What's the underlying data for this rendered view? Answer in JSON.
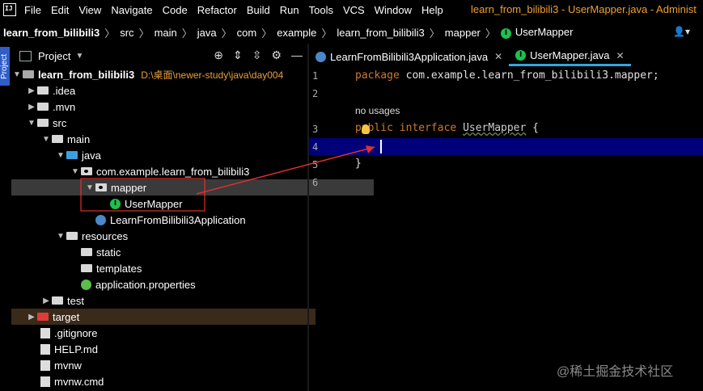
{
  "menu": {
    "logo": "IJ",
    "items": [
      "File",
      "Edit",
      "View",
      "Navigate",
      "Code",
      "Refactor",
      "Build",
      "Run",
      "Tools",
      "VCS",
      "Window",
      "Help"
    ],
    "window_title": "learn_from_bilibili3 - UserMapper.java - Administ"
  },
  "breadcrumb": [
    "learn_from_bilibili3",
    "src",
    "main",
    "java",
    "com",
    "example",
    "learn_from_bilibili3",
    "mapper",
    "UserMapper"
  ],
  "side_tab": "Project",
  "project": {
    "title": "Project",
    "root_name": "learn_from_bilibili3",
    "root_path": "D:\\桌面\\newer-study\\java\\day004",
    "nodes": [
      {
        "label": ".idea"
      },
      {
        "label": ".mvn"
      },
      {
        "label": "src"
      },
      {
        "label": "main"
      },
      {
        "label": "java"
      },
      {
        "label": "com.example.learn_from_bilibili3"
      },
      {
        "label": "mapper"
      },
      {
        "label": "UserMapper"
      },
      {
        "label": "LearnFromBilibili3Application"
      },
      {
        "label": "resources"
      },
      {
        "label": "static"
      },
      {
        "label": "templates"
      },
      {
        "label": "application.properties"
      },
      {
        "label": "test"
      },
      {
        "label": "target"
      },
      {
        "label": ".gitignore"
      },
      {
        "label": "HELP.md"
      },
      {
        "label": "mvnw"
      },
      {
        "label": "mvnw.cmd"
      }
    ]
  },
  "tabs": [
    {
      "label": "LearnFromBilibili3Application.java"
    },
    {
      "label": "UserMapper.java"
    }
  ],
  "editor": {
    "line_numbers": [
      "1",
      "2",
      "3",
      "4",
      "5",
      "6"
    ],
    "line1_kw": "package",
    "line1_rest": " com.example.learn_from_bilibili3.mapper;",
    "usages_hint": "no usages",
    "line3_kw": "public interface",
    "line3_cls": "UserMapper",
    "line3_rest": " {",
    "line5": "}"
  },
  "watermark": "@稀土掘金技术社区",
  "colors": {
    "accent_tab": "#36a5dc",
    "current_line": "#00007a",
    "annotation_red": "#e03030"
  }
}
